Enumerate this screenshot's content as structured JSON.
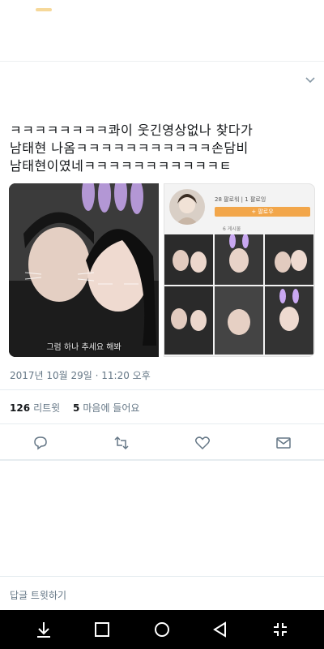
{
  "tweet": {
    "lines": [
      "ㅋㅋㅋㅋㅋㅋㅋㅋ콰이 웃긴영상없나 찾다가",
      "남태현 나옴ㅋㅋㅋㅋㅋㅋㅋㅋㅋㅋㅋ손담비",
      "남태현이였네ㅋㅋㅋㅋㅋㅋㅋㅋㅋㅋㅋㅌ"
    ],
    "media": {
      "left_caption": "그럼 하나 추세요 해봐",
      "right_stats": "28 팔로워  |  1 팔로잉",
      "right_follow": "+ 팔로우",
      "right_posts": "6 게시물"
    },
    "timestamp": "2017년 10월 29일 · 11:20 오후",
    "retweets_count": "126",
    "retweets_label": "리트윗",
    "likes_count": "5",
    "likes_label": "마음에 들어요"
  },
  "reply": {
    "placeholder": "답글 트윗하기"
  },
  "colors": {
    "accent": "#1da1f2",
    "muted": "#657786",
    "text": "#14171a"
  },
  "icons": [
    "chevron-down-icon",
    "reply-icon",
    "retweet-icon",
    "like-icon",
    "mail-icon",
    "nav-download-icon",
    "nav-square-icon",
    "nav-home-icon",
    "nav-back-icon",
    "nav-collapse-icon"
  ]
}
